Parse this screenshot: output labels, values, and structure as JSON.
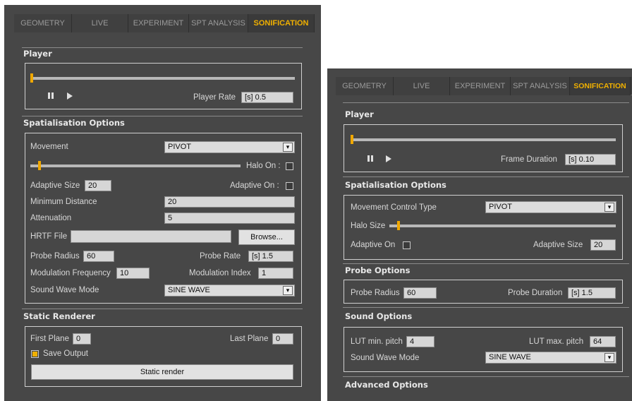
{
  "left": {
    "tabs": [
      {
        "label": "GEOMETRY",
        "active": false
      },
      {
        "label": "LIVE",
        "active": false
      },
      {
        "label": "EXPERIMENT",
        "active": false
      },
      {
        "label": "SPT ANALYSIS",
        "active": false
      },
      {
        "label": "SONIFICATION",
        "active": true
      }
    ],
    "player": {
      "title": "Player",
      "position": 0.0,
      "rate_label": "Player Rate",
      "rate_value": "[s] 0.5"
    },
    "spatialisation": {
      "title": "Spatialisation Options",
      "movement_label": "Movement",
      "movement_value": "PIVOT",
      "halo_slider_value": 0.04,
      "halo_label": "Halo On :",
      "halo_checked": false,
      "adaptive_size_label": "Adaptive Size",
      "adaptive_size_value": "20",
      "adaptive_on_label": "Adaptive On :",
      "adaptive_on_checked": false,
      "min_distance_label": "Minimum Distance",
      "min_distance_value": "20",
      "attenuation_label": "Attenuation",
      "attenuation_value": "5",
      "hrtf_label": "HRTF File",
      "hrtf_value": "",
      "browse_label": "Browse...",
      "probe_radius_label": "Probe Radius",
      "probe_radius_value": "60",
      "probe_rate_label": "Probe Rate",
      "probe_rate_value": "[s] 1.5",
      "mod_freq_label": "Modulation Frequency",
      "mod_freq_value": "10",
      "mod_index_label": "Modulation Index",
      "mod_index_value": "1",
      "wave_mode_label": "Sound Wave Mode",
      "wave_mode_value": "SINE WAVE"
    },
    "static_renderer": {
      "title": "Static Renderer",
      "first_plane_label": "First Plane",
      "first_plane_value": "0",
      "last_plane_label": "Last Plane",
      "last_plane_value": "0",
      "save_output_label": "Save Output",
      "save_output_checked": true,
      "render_button": "Static render"
    }
  },
  "right": {
    "tabs": [
      {
        "label": "GEOMETRY",
        "active": false
      },
      {
        "label": "LIVE",
        "active": false
      },
      {
        "label": "EXPERIMENT",
        "active": false
      },
      {
        "label": "SPT ANALYSIS",
        "active": false
      },
      {
        "label": "SONIFICATION",
        "active": true
      }
    ],
    "player": {
      "title": "Player",
      "position": 0.0,
      "frame_duration_label": "Frame Duration",
      "frame_duration_value": "[s] 0.10"
    },
    "spatialisation": {
      "title": "Spatialisation Options",
      "movement_label": "Movement Control Type",
      "movement_value": "PIVOT",
      "halo_size_label": "Halo Size",
      "halo_size_value": 0.04,
      "adaptive_on_label": "Adaptive On",
      "adaptive_on_checked": false,
      "adaptive_size_label": "Adaptive Size",
      "adaptive_size_value": "20"
    },
    "probe": {
      "title": "Probe Options",
      "radius_label": "Probe Radius",
      "radius_value": "60",
      "duration_label": "Probe Duration",
      "duration_value": "[s] 1.5"
    },
    "sound": {
      "title": "Sound Options",
      "lut_min_label": "LUT min. pitch",
      "lut_min_value": "4",
      "lut_max_label": "LUT max. pitch",
      "lut_max_value": "64",
      "wave_mode_label": "Sound Wave Mode",
      "wave_mode_value": "SINE WAVE"
    },
    "advanced": {
      "title": "Advanced Options"
    }
  },
  "icons": {
    "pause": "pause-icon",
    "play": "play-icon",
    "dropdown": "chevron-down-icon"
  },
  "colors": {
    "panel": "#474747",
    "accent": "#f0b000",
    "field": "#d6d6d6"
  }
}
